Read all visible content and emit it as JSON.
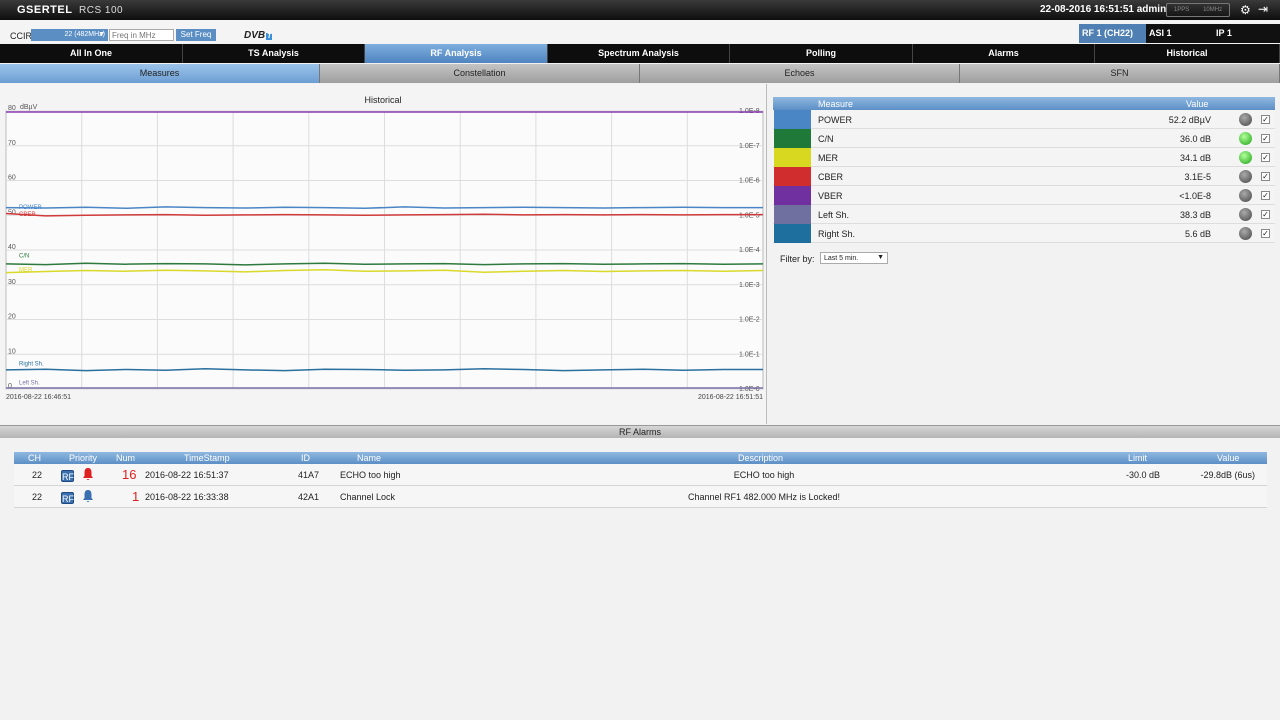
{
  "app": {
    "brand": "GSERTEL",
    "model": "RCS 100",
    "datetime": "22-08-2016 16:51:51 admin",
    "ref_labels": [
      "1PPS",
      "10MHz"
    ]
  },
  "freq": {
    "ccir_label": "CCIR",
    "selected": "22 (482MHz)",
    "freq_placeholder": "Freq in MHz",
    "set_label": "Set Freq",
    "dvb_label": "DVB",
    "dvb_badge": "T"
  },
  "ports": [
    {
      "label": "RF 1 (CH22)",
      "active": true
    },
    {
      "label": "ASI 1",
      "active": false
    },
    {
      "label": "IP 1",
      "active": false
    }
  ],
  "nav": [
    {
      "label": "All In One"
    },
    {
      "label": "TS Analysis"
    },
    {
      "label": "RF Analysis",
      "active": true
    },
    {
      "label": "Spectrum Analysis"
    },
    {
      "label": "Polling"
    },
    {
      "label": "Alarms"
    },
    {
      "label": "Historical"
    }
  ],
  "subnav": [
    {
      "label": "Measures",
      "active": true
    },
    {
      "label": "Constellation"
    },
    {
      "label": "Echoes"
    },
    {
      "label": "SFN"
    }
  ],
  "chart_data": {
    "type": "line",
    "title": "Historical",
    "left_unit": "dBµV",
    "x_start": "2016-08-22 16:46:51",
    "x_end": "2016-08-22 16:51:51",
    "ylim": [
      0,
      80
    ],
    "yticks": [
      0,
      10,
      20,
      30,
      40,
      50,
      60,
      70,
      80
    ],
    "right_ticks": [
      "1.0E-8",
      "1.0E-7",
      "1.0E-6",
      "1.0E-5",
      "1.0E-4",
      "1.0E-3",
      "1.0E-2",
      "1.0E-1",
      "1.0E-0"
    ],
    "grid": true,
    "series": [
      {
        "name": "POWER",
        "color": "#4a86c5",
        "label_y": 51.5,
        "values": [
          52.2,
          52.1,
          52.3,
          52.0,
          52.4,
          52.2,
          52.1,
          52.3,
          52.2,
          52.0,
          52.4,
          52.1,
          52.2,
          52.3,
          52.2,
          52.1,
          52.2,
          52.3,
          52.2,
          52.2
        ]
      },
      {
        "name": "CBER",
        "color": "#d03a3a",
        "label_y": 49.5,
        "values": [
          50.5,
          49.8,
          50.0,
          50.1,
          50.2,
          50.0,
          50.1,
          50.2,
          50.1,
          50.0,
          50.1,
          50.2,
          50.3,
          50.1,
          50.2,
          50.1,
          50.2,
          50.1,
          50.2,
          50.2
        ]
      },
      {
        "name": "C/N",
        "color": "#2e7a3e",
        "label_y": 37.5,
        "values": [
          36.0,
          35.8,
          36.2,
          35.9,
          36.1,
          36.0,
          35.7,
          36.0,
          36.2,
          35.9,
          36.0,
          36.1,
          35.8,
          36.0,
          36.1,
          35.9,
          36.0,
          36.1,
          35.9,
          36.0
        ]
      },
      {
        "name": "MER",
        "color": "#d9d92a",
        "label_y": 33.5,
        "values": [
          33.5,
          33.8,
          34.1,
          33.9,
          34.2,
          34.0,
          33.7,
          34.1,
          34.3,
          33.9,
          34.0,
          34.2,
          33.6,
          33.9,
          34.1,
          33.8,
          34.0,
          34.1,
          33.9,
          34.1
        ]
      },
      {
        "name": "Right Sh.",
        "color": "#2a6f9e",
        "label_y": 6.5,
        "values": [
          5.5,
          5.7,
          5.3,
          5.6,
          5.4,
          5.8,
          5.5,
          5.3,
          5.7,
          5.6,
          5.4,
          5.5,
          5.8,
          5.6,
          5.3,
          5.5,
          5.7,
          5.4,
          5.6,
          5.6
        ]
      },
      {
        "name": "Left Sh.",
        "color": "#7a6fa6",
        "label_y": 1,
        "values": [
          38.3,
          38.3,
          38.3,
          38.3,
          38.3,
          38.3,
          38.3,
          38.3,
          38.3,
          38.3,
          38.3,
          38.3,
          38.3,
          38.3,
          38.3,
          38.3,
          38.3,
          38.3,
          38.3,
          38.3
        ]
      }
    ]
  },
  "measures": {
    "headers": {
      "measure": "Measure",
      "value": "Value"
    },
    "rows": [
      {
        "name": "POWER",
        "value": "52.2 dBµV",
        "color": "#4a86c5",
        "ok": false
      },
      {
        "name": "C/N",
        "value": "36.0 dB",
        "color": "#1f7a3a",
        "ok": true
      },
      {
        "name": "MER",
        "value": "34.1 dB",
        "color": "#d8d820",
        "ok": true
      },
      {
        "name": "CBER",
        "value": "3.1E-5",
        "color": "#d02e2e",
        "ok": false
      },
      {
        "name": "VBER",
        "value": "<1.0E-8",
        "color": "#7030a0",
        "ok": false
      },
      {
        "name": "Left Sh.",
        "value": "38.3 dB",
        "color": "#7070a0",
        "ok": false
      },
      {
        "name": "Right Sh.",
        "value": "5.6 dB",
        "color": "#1f6f9e",
        "ok": false
      }
    ],
    "filter_label": "Filter by:",
    "filter_value": "Last 5 min."
  },
  "alarms": {
    "title": "RF Alarms",
    "headers": {
      "ch": "CH",
      "priority": "Priority",
      "num": "Num",
      "timestamp": "TimeStamp",
      "id": "ID",
      "name": "Name",
      "description": "Description",
      "limit": "Limit",
      "value": "Value"
    },
    "rows": [
      {
        "ch": "22",
        "badge": "RF",
        "bell": "#e02020",
        "num": "16",
        "timestamp": "2016-08-22 16:51:37",
        "id": "41A7",
        "name": "ECHO too high",
        "description": "ECHO too high",
        "limit": "-30.0 dB",
        "value": "-29.8dB (6us)"
      },
      {
        "ch": "22",
        "badge": "RF",
        "bell": "#3a6fb0",
        "num": "1",
        "timestamp": "2016-08-22 16:33:38",
        "id": "42A1",
        "name": "Channel Lock",
        "description": "Channel RF1 482.000 MHz is Locked!",
        "limit": "",
        "value": ""
      }
    ]
  }
}
